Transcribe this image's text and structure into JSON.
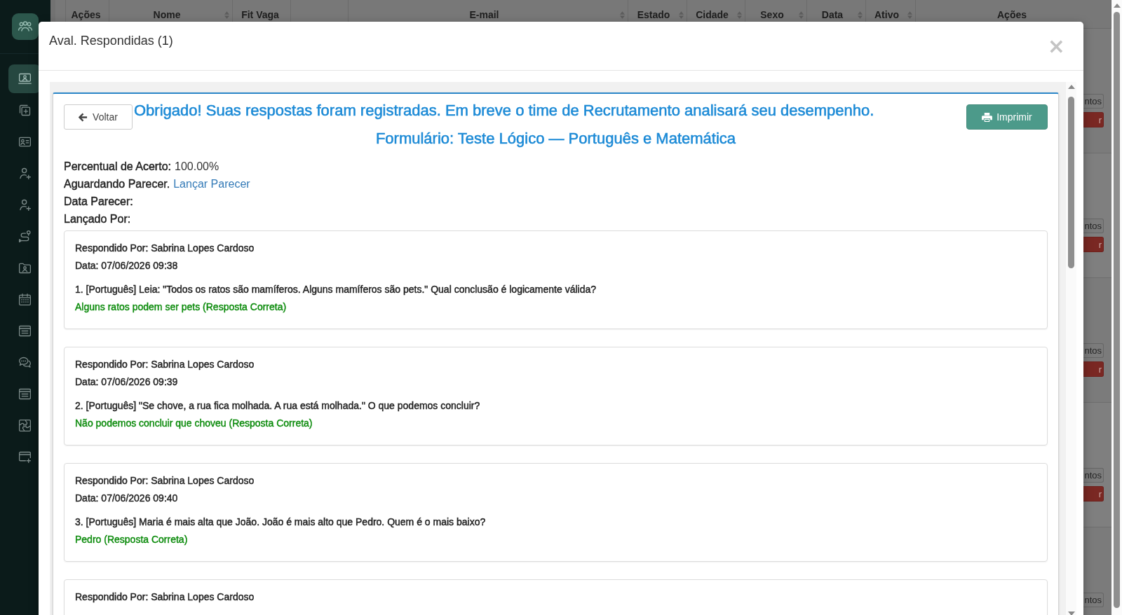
{
  "sidebar": {
    "items": [
      {
        "selected": true
      },
      {
        "selected": false
      },
      {
        "selected": false
      },
      {
        "selected": false
      },
      {
        "selected": false
      },
      {
        "selected": false
      },
      {
        "selected": false
      },
      {
        "selected": false
      },
      {
        "selected": false
      },
      {
        "selected": false
      },
      {
        "selected": false
      },
      {
        "selected": false
      },
      {
        "selected": false
      }
    ]
  },
  "table": {
    "columns": [
      {
        "label": "Ações",
        "sortable": false
      },
      {
        "label": "Nome",
        "sortable": true
      },
      {
        "label": "Fit Vaga",
        "sortable": false
      },
      {
        "label": "E-mail",
        "sortable": true
      },
      {
        "label": "Estado",
        "sortable": true
      },
      {
        "label": "Cidade",
        "sortable": true
      },
      {
        "label": "Sexo",
        "sortable": true
      },
      {
        "label": "Data",
        "sortable": true
      },
      {
        "label": "Ativo",
        "sortable": true
      },
      {
        "label": "Ações",
        "sortable": false
      }
    ],
    "rows": [
      {
        "buttons": [
          {
            "kind": "default",
            "label": "ntos"
          },
          {
            "kind": "danger",
            "label": "r"
          }
        ]
      },
      {
        "buttons": [
          {
            "kind": "default",
            "label": "ntos"
          },
          {
            "kind": "danger",
            "label": "r"
          }
        ]
      },
      {
        "buttons": [
          {
            "kind": "default",
            "label": "ntos"
          },
          {
            "kind": "danger",
            "label": "r"
          }
        ]
      },
      {
        "buttons": [
          {
            "kind": "default",
            "label": "ntos"
          },
          {
            "kind": "danger",
            "label": "r"
          }
        ]
      },
      {
        "buttons": [
          {
            "kind": "default",
            "label": "ntos"
          }
        ]
      }
    ]
  },
  "modal": {
    "title": "Aval. Respondidas (1)",
    "close": "×",
    "back_button": "Voltar",
    "print_button": "Imprimir",
    "message": "Obrigado! Suas respostas foram registradas. Em breve o time de Recrutamento analisará seu desempenho.",
    "form_title": "Formulário: Teste Lógico — Português e Matemática",
    "fields": [
      {
        "kind": "value",
        "label": "Percentual de Acerto:",
        "value": "100.00%"
      },
      {
        "kind": "link",
        "label": "Aguardando Parecer.",
        "link": "Lançar Parecer"
      },
      {
        "kind": "label",
        "label": "Data Parecer:"
      },
      {
        "kind": "label",
        "label": "Lançado Por:"
      }
    ],
    "answers": [
      {
        "respondent": "Respondido Por: Sabrina Lopes Cardoso",
        "date": "Data: 07/06/2026 09:38",
        "question": "1. [Português] Leia: \"Todos os ratos são mamíferos. Alguns mamíferos são pets.\" Qual conclusão é logicamente válida?",
        "answer": "Alguns ratos podem ser pets (Resposta Correta)",
        "correct": true
      },
      {
        "respondent": "Respondido Por: Sabrina Lopes Cardoso",
        "date": "Data: 07/06/2026 09:39",
        "question": "2. [Português] \"Se chove, a rua fica molhada. A rua está molhada.\" O que podemos concluir?",
        "answer": "Não podemos concluir que choveu (Resposta Correta)",
        "correct": true
      },
      {
        "respondent": "Respondido Por: Sabrina Lopes Cardoso",
        "date": "Data: 07/06/2026 09:40",
        "question": "3. [Português] Maria é mais alta que João. João é mais alto que Pedro. Quem é o mais baixo?",
        "answer": "Pedro (Resposta Correta)",
        "correct": true
      },
      {
        "respondent": "Respondido Por: Sabrina Lopes Cardoso"
      }
    ]
  }
}
